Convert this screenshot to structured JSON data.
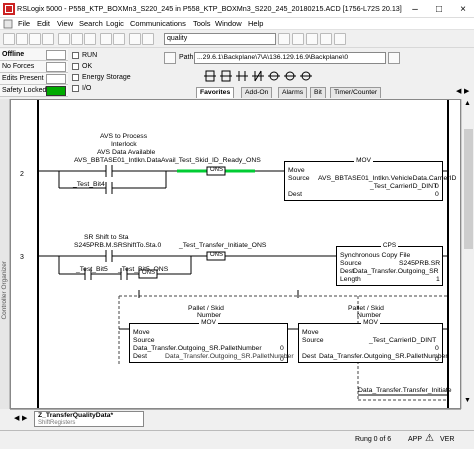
{
  "window": {
    "title": "RSLogix 5000 - P558_KTP_BOXMn3_S220_245 in P558_KTP_BOXMn3_S220_245_20180215.ACD [1756-L72S 20.13]* - [ShiftRegis..."
  },
  "menu": [
    "File",
    "Edit",
    "View",
    "Search",
    "Logic",
    "Communications",
    "Tools",
    "Window",
    "Help"
  ],
  "toolbar": {
    "search_combo": "quality"
  },
  "status": {
    "mode": "Offline",
    "forces": "No Forces",
    "edits": "Edits Present",
    "safety": "Safety Locked"
  },
  "checks": [
    "RUN",
    "OK",
    "Energy Storage",
    "I/O"
  ],
  "path": {
    "label": "Path:",
    "value": "...29.6.1\\Backplane\\7\\A\\136.129.16.9\\Backplane\\0"
  },
  "tabs": [
    "Favorites",
    "Add-On",
    "Alarms",
    "Bit",
    "Timer/Counter"
  ],
  "sidebar": {
    "label": "Controller Organizer"
  },
  "ladder": {
    "rungs": [
      {
        "number": "2",
        "comment": [
          "AVS to Process",
          "Interlock",
          "AVS Data Available"
        ],
        "xic1_tag": "AVS_BBTASE01_Intlkn.DataAvail",
        "ons_tag": "_Test_Skid_ID_Ready_ONS",
        "ons_label": "ONS",
        "branch_tag": "_Test_Bit4",
        "instr": {
          "title": "MOV",
          "name": "Move",
          "source_label": "Source",
          "source_value": "AVS_BBTASE01_Intlkn.VehicleData.CarrierID",
          "dest_label": "Dest",
          "dest_value": "_Test_CarrierID_DINT",
          "source_sub": "0",
          "dest_sub": "0"
        }
      },
      {
        "number": "3",
        "comment": [
          "SR Shift to Sta"
        ],
        "xic1_tag": "S245PRB.M.SRShiftTo.Sta.0",
        "ons_tag": "_Test_Transfer_Initiate_ONS",
        "ons_label": "ONS",
        "branch_tag1": "_Test_Bit5",
        "branch_tag2": "_Test_Bit5_ONS",
        "branch_ons": "ONS",
        "instr": {
          "title": "CPS",
          "name": "Synchronous Copy File",
          "source_label": "Source",
          "source_value": "S245PRB.SR",
          "dest_label": "Dest",
          "dest_value": "Data_Transfer.Outgoing_SR",
          "length_label": "Length",
          "length_value": "1"
        },
        "mov1": {
          "comment": [
            "Pallet / Skid",
            "Number"
          ],
          "title": "MOV",
          "name": "Move",
          "source_label": "Source",
          "source_value": "Data_Transfer.Outgoing_SR.PalletNumber",
          "source_sub": "0",
          "dest_label": "Dest",
          "dest_value": "Data_Transfer.Outgoing_SR.PalletNumber",
          "dest_sub": "0"
        },
        "mov2": {
          "comment": [
            "Pallet / Skid",
            "Number"
          ],
          "title": "MOV",
          "name": "Move",
          "source_label": "Source",
          "source_value": "_Test_CarrierID_DINT",
          "source_sub": "0",
          "dest_label": "Dest",
          "dest_value": "Data_Transfer.Outgoing_SR.PalletNumber",
          "dest_sub": "0"
        },
        "ote_tag": "Data_Transfer.Transfer_Initiate"
      }
    ]
  },
  "bottom": {
    "routine_tab": "Z_TransferQualityData*",
    "routine_sub": "ShiftRegisters"
  },
  "statusbar": {
    "rung": "Rung 0 of 6",
    "app": "APP",
    "ver": "VER"
  },
  "colors": {
    "ons_active": "#00cc33",
    "rail": "#000000",
    "safety_green": "#00aa00"
  }
}
